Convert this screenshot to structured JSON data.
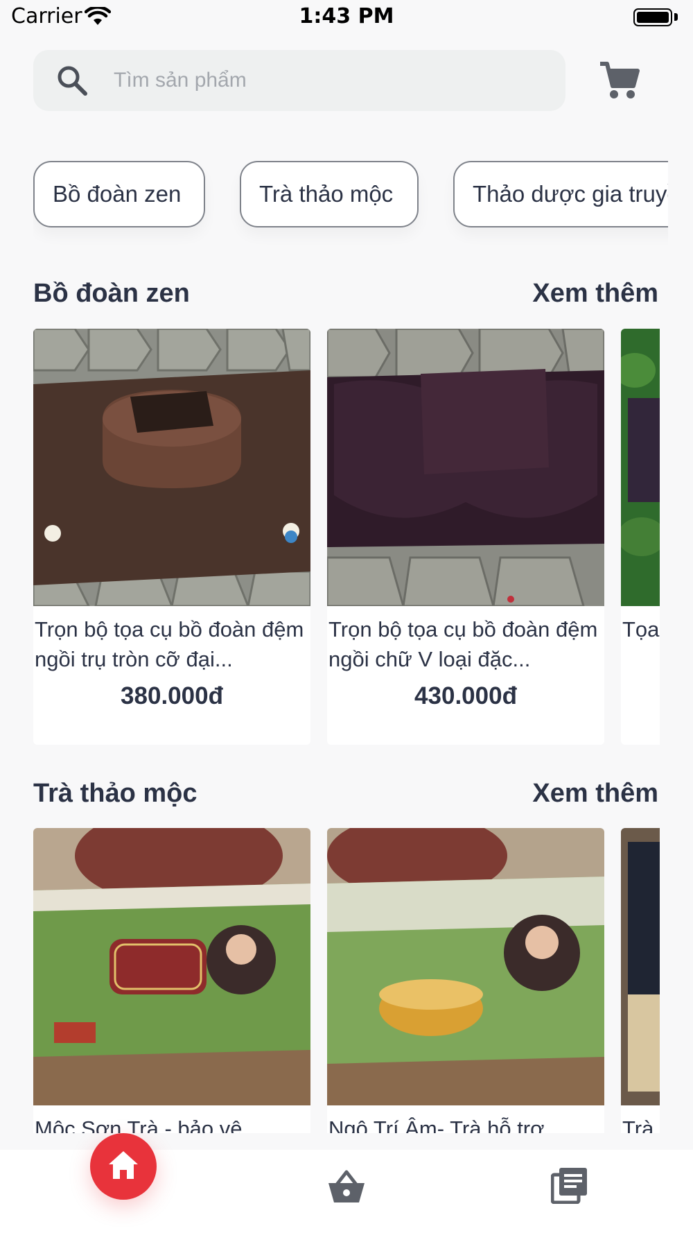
{
  "status_bar": {
    "carrier": "Carrier",
    "time": "1:43 PM"
  },
  "search": {
    "placeholder": "Tìm sản phẩm"
  },
  "categories": [
    "Bồ đoàn zen",
    "Trà thảo mộc",
    "Thảo dược gia truyền"
  ],
  "sections": [
    {
      "title": "Bồ đoàn zen",
      "see_more": "Xem thêm",
      "products": [
        {
          "name": "Trọn bộ tọa cụ bồ đoàn đệm ngồi trụ tròn cỡ đại...",
          "price": "380.000đ"
        },
        {
          "name": "Trọn bộ tọa cụ bồ đoàn đệm ngồi chữ V loại đặc...",
          "price": "430.000đ"
        },
        {
          "name": "Tọa thô",
          "price": ""
        }
      ]
    },
    {
      "title": "Trà thảo mộc",
      "see_more": "Xem thêm",
      "products": [
        {
          "name": "Mộc Sơn Trà - bảo vệ",
          "price": ""
        },
        {
          "name": "Ngộ Trí Âm- Trà hỗ trợ",
          "price": ""
        },
        {
          "name": "Trà",
          "price": ""
        }
      ]
    }
  ],
  "nav": [
    "home-icon",
    "basket-icon",
    "news-icon"
  ],
  "colors": {
    "accent": "#e8333b",
    "text": "#2b3245",
    "background": "#f8f8f9"
  }
}
